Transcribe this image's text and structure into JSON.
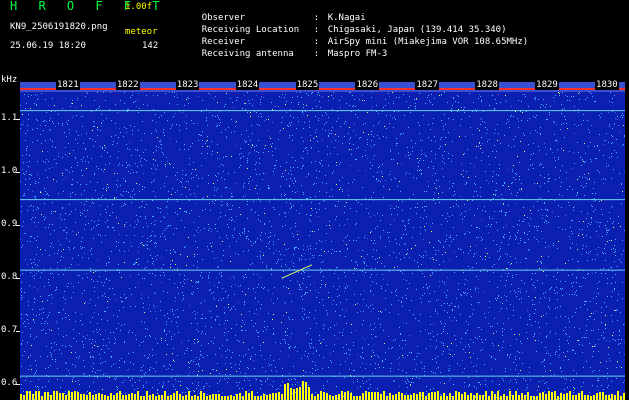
{
  "header": {
    "app_title": "H R O F F T",
    "version": "1.00f",
    "filename": "KN9_2506191820.png",
    "meteor_label": "meteor",
    "timestamp": "25.06.19 18:20",
    "meteor_count": "142"
  },
  "info": [
    {
      "label": "Observer",
      "sep": ":",
      "value": "K.Nagai"
    },
    {
      "label": "Receiving Location",
      "sep": ":",
      "value": "Chigasaki, Japan (139.414 35.340)"
    },
    {
      "label": "Receiver",
      "sep": ":",
      "value": "AirSpy mini (Miakejima VOR 108.65MHz)"
    },
    {
      "label": "Receiving antenna",
      "sep": ":",
      "value": "Maspro FM-3"
    }
  ],
  "spectrogram": {
    "y_unit": "kHz",
    "y_ticks": [
      "1.1",
      "1.0",
      "0.9",
      "0.8",
      "0.7",
      "0.6"
    ],
    "y_range": [
      0.57,
      1.17
    ],
    "time_labels": [
      "1821",
      "1822",
      "1823",
      "1824",
      "1825",
      "1826",
      "1827",
      "1828",
      "1829",
      "1830"
    ],
    "colors": {
      "background": "#0b1fb0",
      "noise_light": "#4ab0ff",
      "noise_bright": "#d0ff60",
      "trace": "#7fffff",
      "level": "#ffff00"
    }
  }
}
